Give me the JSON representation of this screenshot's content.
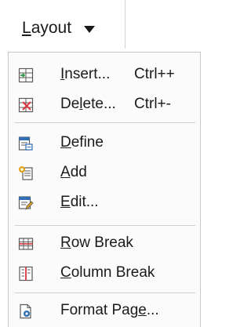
{
  "toolbar": {
    "layout_button": {
      "label": "Layout",
      "mnemonic": "L",
      "rest": "ayout"
    }
  },
  "menu": {
    "items": [
      {
        "id": "insert",
        "label_pre": "",
        "mnemonic": "I",
        "label_post": "nsert...",
        "shortcut": "Ctrl++",
        "icon": "insert-rows-icon"
      },
      {
        "id": "delete",
        "label_pre": "De",
        "mnemonic": "l",
        "label_post": "ete...",
        "shortcut": "Ctrl+-",
        "icon": "delete-rows-icon"
      },
      {
        "id": "define",
        "label_pre": "",
        "mnemonic": "D",
        "label_post": "efine",
        "shortcut": "",
        "icon": "define-icon"
      },
      {
        "id": "add",
        "label_pre": "",
        "mnemonic": "A",
        "label_post": "dd",
        "shortcut": "",
        "icon": "add-icon"
      },
      {
        "id": "edit",
        "label_pre": "",
        "mnemonic": "E",
        "label_post": "dit...",
        "shortcut": "",
        "icon": "edit-icon"
      },
      {
        "id": "row-break",
        "label_pre": "",
        "mnemonic": "R",
        "label_post": "ow Break",
        "shortcut": "",
        "icon": "row-break-icon"
      },
      {
        "id": "column-break",
        "label_pre": "",
        "mnemonic": "C",
        "label_post": "olumn Break",
        "shortcut": "",
        "icon": "column-break-icon"
      },
      {
        "id": "format-page",
        "label_pre": "Format Pag",
        "mnemonic": "e",
        "label_post": "...",
        "shortcut": "",
        "icon": "format-page-icon"
      }
    ]
  },
  "colors": {
    "accent_green": "#2e9d4a",
    "accent_red": "#d9363e",
    "accent_blue": "#2f6fb5",
    "accent_yellow": "#e0a21b",
    "icon_gray": "#5a5a5a"
  }
}
